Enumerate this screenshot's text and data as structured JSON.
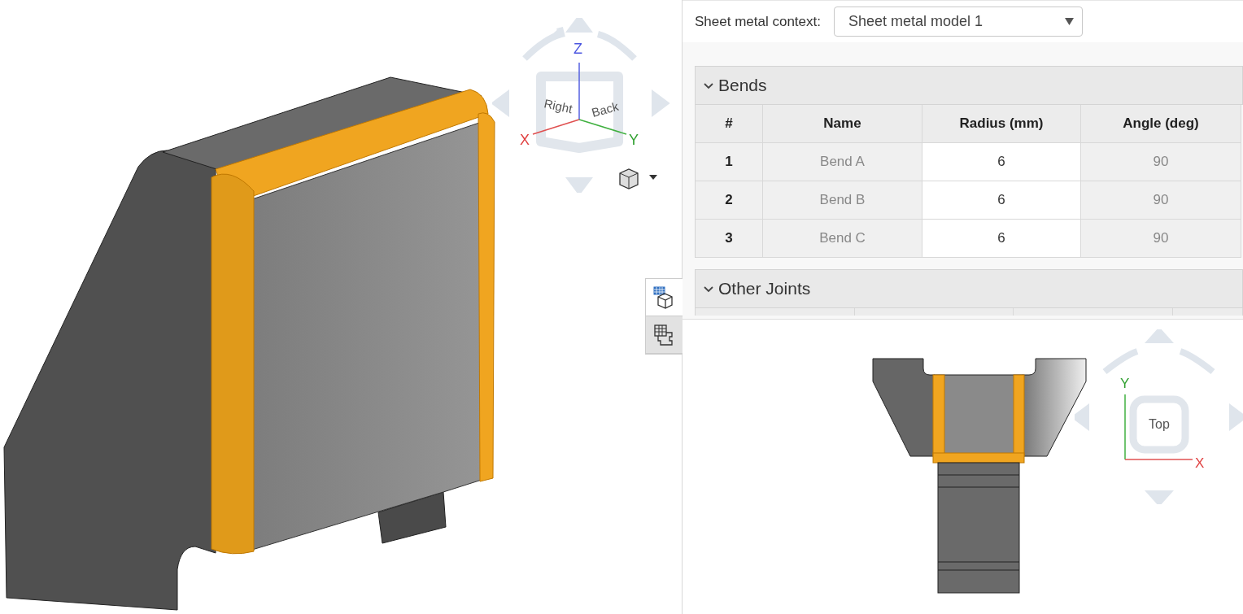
{
  "view_cube": {
    "face_left": "Right",
    "face_right": "Back",
    "axis_x": "X",
    "axis_y": "Y",
    "axis_z": "Z"
  },
  "view_toggles": [
    {
      "kind": "model",
      "selected": false
    },
    {
      "kind": "flat",
      "selected": true
    }
  ],
  "context": {
    "label": "Sheet metal context:",
    "value": "Sheet metal model 1"
  },
  "sections": [
    {
      "title": "Bends",
      "expanded": true,
      "table": {
        "columns": [
          {
            "label": "#",
            "editable": false
          },
          {
            "label": "Name",
            "editable": false
          },
          {
            "label": "Radius (mm)",
            "editable": true
          },
          {
            "label": "Angle (deg)",
            "editable": false
          }
        ],
        "rows": [
          [
            "1",
            "Bend A",
            "6",
            "90"
          ],
          [
            "2",
            "Bend B",
            "6",
            "90"
          ],
          [
            "3",
            "Bend C",
            "6",
            "90"
          ]
        ]
      }
    },
    {
      "title": "Other Joints",
      "expanded": true
    }
  ],
  "flat_view_cube": {
    "face": "Top",
    "axis_x": "X",
    "axis_y": "Y"
  }
}
